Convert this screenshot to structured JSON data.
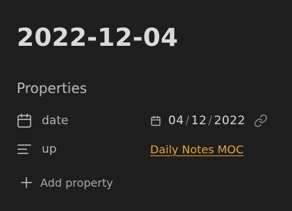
{
  "note": {
    "title": "2022-12-04"
  },
  "properties": {
    "heading": "Properties",
    "items": [
      {
        "key": "date",
        "icon": "calendar-icon",
        "value": {
          "day": "04",
          "month": "12",
          "year": "2022",
          "separator": "/"
        },
        "trailing_icon": "link-icon"
      },
      {
        "key": "up",
        "icon": "text-lines-icon",
        "value": "Daily Notes MOC",
        "link_color": "#e5a433"
      }
    ],
    "add_label": "Add property",
    "add_icon": "plus-icon"
  },
  "colors": {
    "background": "#1e1e1e",
    "text": "#dadada",
    "muted": "#b3b3b3",
    "accent": "#e5a433"
  }
}
